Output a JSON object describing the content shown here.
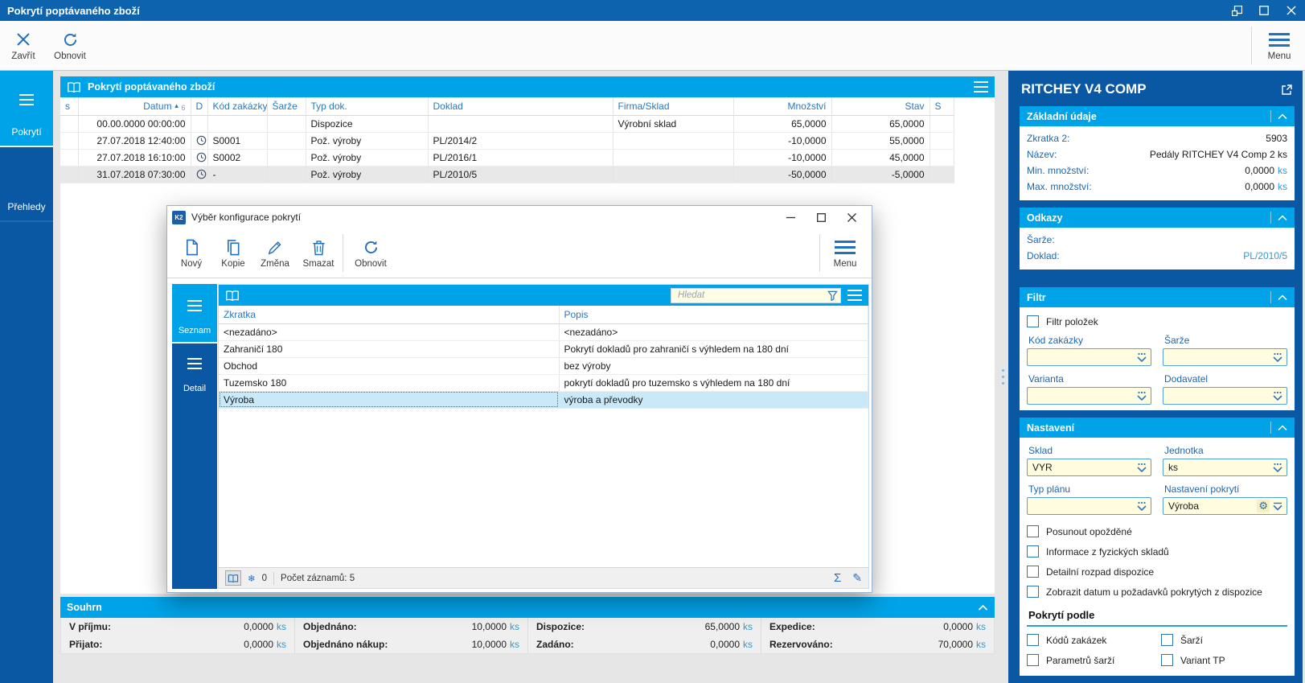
{
  "titlebar": {
    "title": "Pokrytí poptávaného zboží"
  },
  "toolbar": {
    "close": "Zavřít",
    "refresh": "Obnovit",
    "menu": "Menu"
  },
  "nav": {
    "tabs": [
      "Pokrytí",
      "Přehledy"
    ]
  },
  "grid": {
    "title": "Pokrytí poptávaného zboží",
    "headers": {
      "s": "s",
      "datum": "Datum",
      "sort_arrow": "▲",
      "sort_num": "6",
      "d": "D",
      "kod": "Kód zakázky",
      "sarze": "Šarže",
      "typ": "Typ dok.",
      "doklad": "Doklad",
      "firma": "Firma/Sklad",
      "mnozstvi": "Množství",
      "stav": "Stav",
      "status": "S"
    },
    "rows": [
      {
        "datum": "00.00.0000 00:00:00",
        "kod": "",
        "sarze": "",
        "typ": "Dispozice",
        "doklad": "",
        "firma": "Výrobní sklad",
        "mnozstvi": "65,0000",
        "stav": "65,0000"
      },
      {
        "datum": "27.07.2018 12:40:00",
        "kod": "S0001",
        "sarze": "",
        "typ": "Pož. výroby",
        "doklad": "PL/2014/2",
        "firma": "",
        "mnozstvi": "-10,0000",
        "stav": "55,0000"
      },
      {
        "datum": "27.07.2018 16:10:00",
        "kod": "S0002",
        "sarze": "",
        "typ": "Pož. výroby",
        "doklad": "PL/2016/1",
        "firma": "",
        "mnozstvi": "-10,0000",
        "stav": "45,0000"
      },
      {
        "datum": "31.07.2018 07:30:00",
        "kod": "-",
        "sarze": "",
        "typ": "Pož. výroby",
        "doklad": "PL/2010/5",
        "firma": "",
        "mnozstvi": "-50,0000",
        "stav": "-5,0000"
      }
    ]
  },
  "dialog": {
    "title": "Výběr konfigurace pokrytí",
    "app_icon_text": "K2",
    "toolbar": {
      "new": "Nový",
      "copy": "Kopie",
      "change": "Změna",
      "delete": "Smazat",
      "refresh": "Obnovit",
      "menu": "Menu"
    },
    "tabs": [
      "Seznam",
      "Detail"
    ],
    "search_placeholder": "Hledat",
    "headers": {
      "zkratka": "Zkratka",
      "popis": "Popis"
    },
    "rows": [
      {
        "zkratka": "<nezadáno>",
        "popis": "<nezadáno>"
      },
      {
        "zkratka": "Zahraničí 180",
        "popis": "Pokrytí dokladů pro zahraničí s výhledem na 180 dní"
      },
      {
        "zkratka": "Obchod",
        "popis": "bez výroby"
      },
      {
        "zkratka": "Tuzemsko 180",
        "popis": "pokrytí dokladů pro tuzemsko s výhledem na 180 dní"
      },
      {
        "zkratka": "Výroba",
        "popis": "výroba a převodky"
      }
    ],
    "statusbar": {
      "frozen_count": "0",
      "records": "Počet záznamů: 5",
      "sigma": "Σ",
      "pencil": "✎",
      "snowflake": "❄"
    }
  },
  "summary": {
    "title": "Souhrn",
    "items": [
      {
        "label": "V příjmu:",
        "value": "0,0000",
        "unit": "ks"
      },
      {
        "label": "Objednáno:",
        "value": "10,0000",
        "unit": "ks"
      },
      {
        "label": "Dispozice:",
        "value": "65,0000",
        "unit": "ks"
      },
      {
        "label": "Expedice:",
        "value": "0,0000",
        "unit": "ks"
      },
      {
        "label": "Přijato:",
        "value": "0,0000",
        "unit": "ks"
      },
      {
        "label": "Objednáno nákup:",
        "value": "10,0000",
        "unit": "ks"
      },
      {
        "label": "Zadáno:",
        "value": "0,0000",
        "unit": "ks"
      },
      {
        "label": "Rezervováno:",
        "value": "70,0000",
        "unit": "ks"
      }
    ]
  },
  "detail_panel": {
    "title": "RITCHEY V4 COMP",
    "basic": {
      "title": "Základní údaje",
      "rows": [
        {
          "label": "Zkratka 2:",
          "value": "5903",
          "unit": ""
        },
        {
          "label": "Název:",
          "value": "Pedály RITCHEY V4 Comp 2 ks",
          "unit": ""
        },
        {
          "label": "Min. množství:",
          "value": "0,0000",
          "unit": "ks"
        },
        {
          "label": "Max. množství:",
          "value": "0,0000",
          "unit": "ks"
        }
      ]
    },
    "links": {
      "title": "Odkazy",
      "rows": [
        {
          "label": "Šarže:",
          "value": ""
        },
        {
          "label": "Doklad:",
          "value": "PL/2010/5"
        }
      ]
    },
    "filter": {
      "title": "Filtr",
      "checkbox": "Filtr položek",
      "fields": [
        {
          "label": "Kód zakázky",
          "value": ""
        },
        {
          "label": "Šarže",
          "value": ""
        },
        {
          "label": "Varianta",
          "value": ""
        },
        {
          "label": "Dodavatel",
          "value": ""
        }
      ]
    },
    "settings": {
      "title": "Nastavení",
      "fields": [
        {
          "label": "Sklad",
          "value": "VYR"
        },
        {
          "label": "Jednotka",
          "value": "ks"
        },
        {
          "label": "Typ plánu",
          "value": ""
        },
        {
          "label": "Nastavení pokrytí",
          "value": "Výroba"
        }
      ],
      "gear_icon": "⚙",
      "checkboxes": [
        "Posunout opožděné",
        "Informace z fyzických skladů",
        "Detailní rozpad dispozice",
        "Zobrazit datum u požadavků pokrytých z dispozice"
      ],
      "coverage_title": "Pokrytí podle",
      "coverage_checkboxes": [
        "Kódů zakázek",
        "Šarží",
        "Parametrů šarží",
        "Variant TP"
      ]
    }
  },
  "colors": {
    "accent_bright": "#00A3E8",
    "accent_navy": "#0A58A4",
    "titlebar": "#0D63AE",
    "status_red": "#EF5E5E",
    "field_yellow": "#FFFCE0"
  }
}
